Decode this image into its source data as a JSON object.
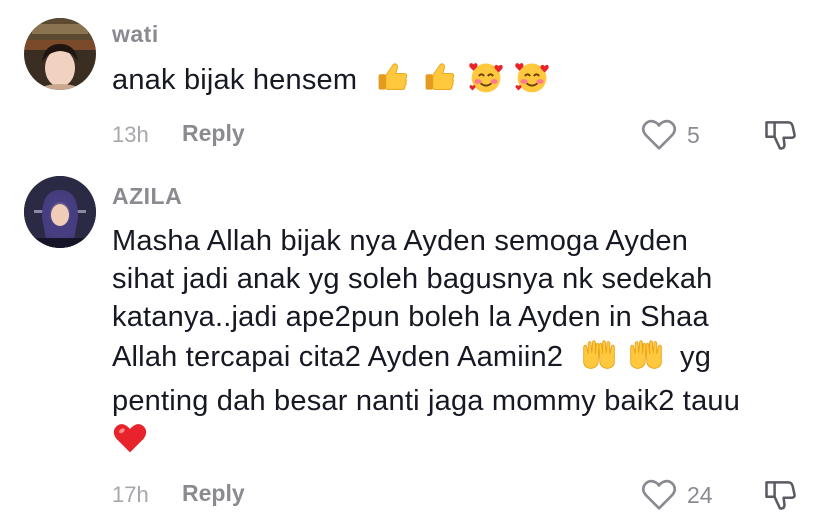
{
  "comments": [
    {
      "author": "wati",
      "text": "anak bijak hensem",
      "emojis": [
        "thumbs-up",
        "thumbs-up",
        "smiling-face-with-hearts",
        "smiling-face-with-hearts"
      ],
      "time": "13h",
      "reply_label": "Reply",
      "like_count": "5"
    },
    {
      "author": "AZILA",
      "lines": [
        "Masha Allah bijak nya Ayden semoga Ayden",
        "sihat jadi anak yg soleh bagusnya nk sedekah",
        "katanya..jadi ape2pun boleh la Ayden in Shaa",
        "Allah tercapai cita2 Ayden Aamiin2",
        "yg",
        "penting dah besar nanti jaga mommy baik2 tauu"
      ],
      "emojis": [
        "palms-up-together",
        "palms-up-together",
        "red-heart"
      ],
      "time": "17h",
      "reply_label": "Reply",
      "like_count": "24"
    }
  ],
  "colors": {
    "text": "#161823",
    "secondary": "#8a8b91",
    "time": "#a6a7ab",
    "emoji_yellow": "#ffc83d",
    "heart_red": "#e8232b"
  }
}
